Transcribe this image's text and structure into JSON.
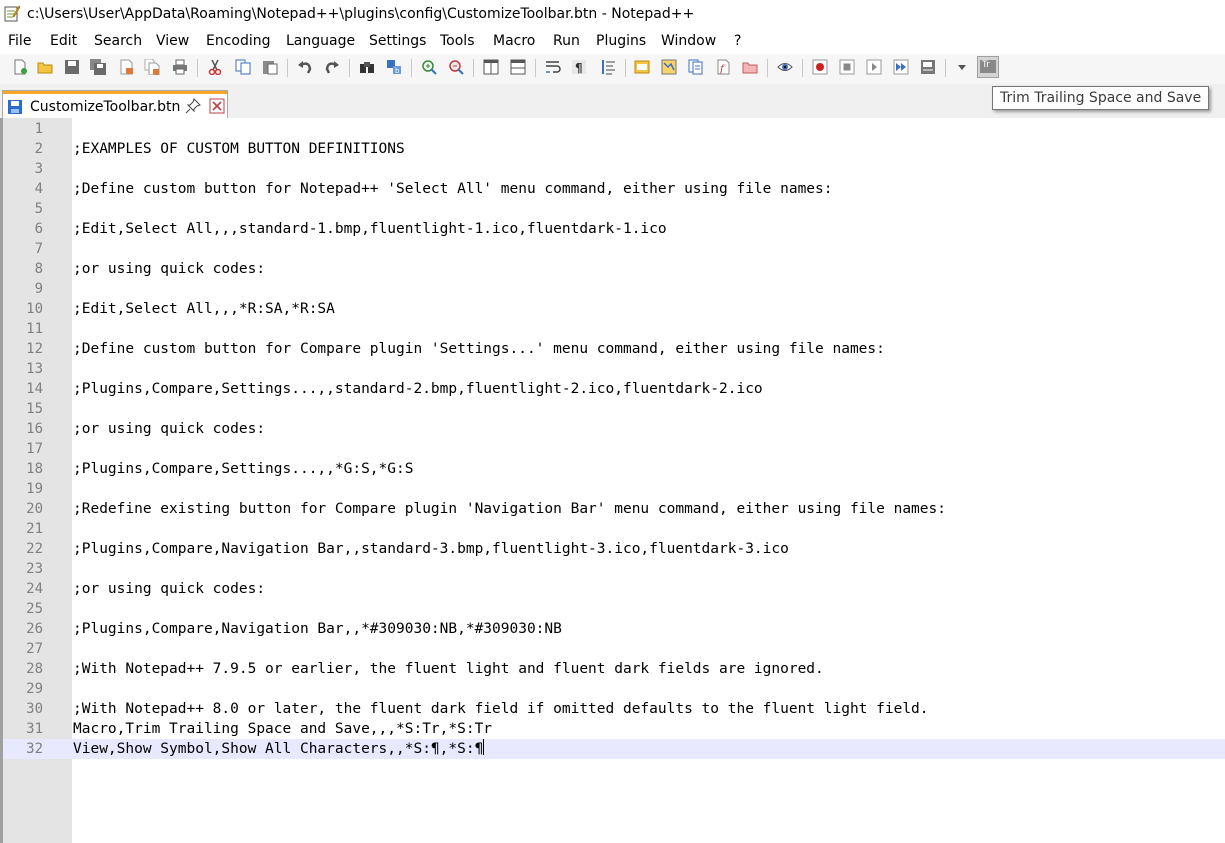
{
  "window": {
    "title": "c:\\Users\\User\\AppData\\Roaming\\Notepad++\\plugins\\config\\CustomizeToolbar.btn - Notepad++",
    "app_icon": "notepad-plus-plus-icon"
  },
  "menu": [
    {
      "label": "File"
    },
    {
      "label": "Edit"
    },
    {
      "label": "Search"
    },
    {
      "label": "View"
    },
    {
      "label": "Encoding"
    },
    {
      "label": "Language"
    },
    {
      "label": "Settings"
    },
    {
      "label": "Tools"
    },
    {
      "label": "Macro"
    },
    {
      "label": "Run"
    },
    {
      "label": "Plugins"
    },
    {
      "label": "Window"
    },
    {
      "label": "?"
    }
  ],
  "toolbar": {
    "buttons": [
      "new-file",
      "open-file",
      "save",
      "save-all",
      "close",
      "close-all",
      "print",
      "cut",
      "copy",
      "paste",
      "undo",
      "redo",
      "find",
      "replace",
      "zoom-in",
      "zoom-out",
      "sync-vertical",
      "sync-horizontal",
      "word-wrap",
      "show-all-characters",
      "indent-guide",
      "define-language",
      "document-map",
      "document-list",
      "function-list",
      "folder-as-workspace",
      "monitoring",
      "record-macro",
      "stop-recording",
      "playback-macro",
      "run-macro-multiple",
      "save-macro",
      "toolbar-dropdown",
      "trim-trailing-space-and-save"
    ],
    "custom_button_text": "Tr"
  },
  "tab": {
    "label": "CustomizeToolbar.btn",
    "accent_color": "#f7a626"
  },
  "tooltip": "Trim Trailing Space and Save",
  "editor": {
    "current_line": 32,
    "lines": [
      "",
      ";EXAMPLES OF CUSTOM BUTTON DEFINITIONS",
      "",
      ";Define custom button for Notepad++ 'Select All' menu command, either using file names:",
      "",
      ";Edit,Select All,,,standard-1.bmp,fluentlight-1.ico,fluentdark-1.ico",
      "",
      ";or using quick codes:",
      "",
      ";Edit,Select All,,,*R:SA,*R:SA",
      "",
      ";Define custom button for Compare plugin 'Settings...' menu command, either using file names:",
      "",
      ";Plugins,Compare,Settings...,,standard-2.bmp,fluentlight-2.ico,fluentdark-2.ico",
      "",
      ";or using quick codes:",
      "",
      ";Plugins,Compare,Settings...,,*G:S,*G:S",
      "",
      ";Redefine existing button for Compare plugin 'Navigation Bar' menu command, either using file names:",
      "",
      ";Plugins,Compare,Navigation Bar,,standard-3.bmp,fluentlight-3.ico,fluentdark-3.ico",
      "",
      ";or using quick codes:",
      "",
      ";Plugins,Compare,Navigation Bar,,*#309030:NB,*#309030:NB",
      "",
      ";With Notepad++ 7.9.5 or earlier, the fluent light and fluent dark fields are ignored.",
      "",
      ";With Notepad++ 8.0 or later, the fluent dark field if omitted defaults to the fluent light field.",
      "Macro,Trim Trailing Space and Save,,,*S:Tr,*S:Tr",
      "View,Show Symbol,Show All Characters,,*S:¶,*S:¶"
    ]
  }
}
